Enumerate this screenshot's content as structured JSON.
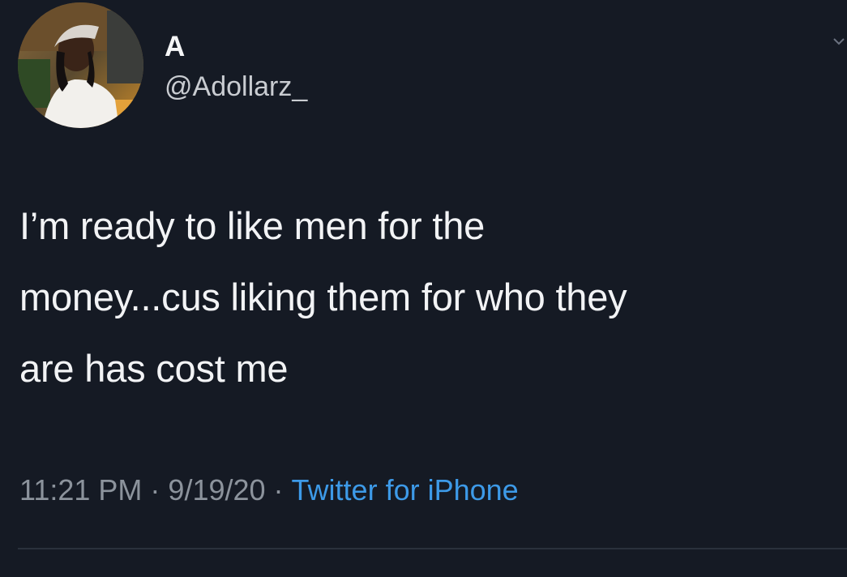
{
  "tweet": {
    "author": {
      "display_name": "A",
      "handle": "@Adollarz_",
      "avatar_icon": "profile-photo"
    },
    "text": "I’m ready to like men for the\nmoney...cus liking them for who they\nare has cost me",
    "time": "11:21 PM",
    "separator": "·",
    "date": "9/19/20",
    "source": "Twitter for iPhone"
  },
  "colors": {
    "background": "#151a24",
    "text": "#f2f3f5",
    "secondary_text": "#8c939c",
    "link": "#3d9ae8"
  }
}
